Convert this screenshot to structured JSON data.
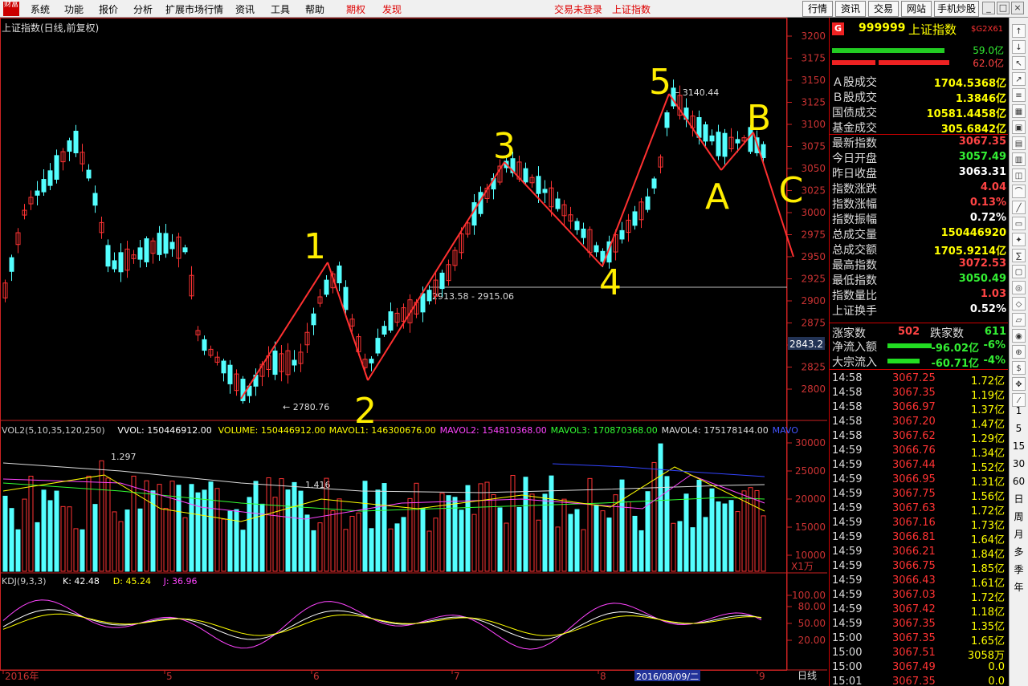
{
  "menubar": {
    "logo": "财富",
    "items": [
      {
        "label": "系统",
        "red": false
      },
      {
        "label": "功能",
        "red": false
      },
      {
        "label": "报价",
        "red": false
      },
      {
        "label": "分析",
        "red": false
      },
      {
        "label": "扩展市场行情",
        "red": false
      },
      {
        "label": "资讯",
        "red": false
      },
      {
        "label": "工具",
        "red": false
      },
      {
        "label": "帮助",
        "red": false
      },
      {
        "label": "期权",
        "red": true
      },
      {
        "label": "发现",
        "red": true
      }
    ],
    "status_login": "交易未登录",
    "status_index": "上证指数",
    "buttons": [
      "行情",
      "资讯",
      "交易",
      "网站",
      "手机炒股"
    ],
    "window_controls": [
      "_",
      "□",
      "×"
    ]
  },
  "chart": {
    "title": "上证指数(日线,前复权)",
    "y_ticks": [
      "3200",
      "3175",
      "3150",
      "3125",
      "3100",
      "3075",
      "3050",
      "3025",
      "3000",
      "2975",
      "2950",
      "2925",
      "2900",
      "2875",
      "2850",
      "2825",
      "2800"
    ],
    "crosshair_value": "2843.2",
    "annotations": {
      "high": "3140.44",
      "low": "2780.76",
      "gap": "2913.58 - 2915.06"
    },
    "wave_labels": [
      "1",
      "2",
      "3",
      "4",
      "5",
      "A",
      "B",
      "C"
    ],
    "volume": {
      "legend": [
        {
          "text": "VOL2(5,10,35,120,250)",
          "color": "#cccccc"
        },
        {
          "text": "VVOL: 150446912.00",
          "color": "#ffffff"
        },
        {
          "text": "VOLUME: 150446912.00",
          "color": "#ffff00"
        },
        {
          "text": "MAVOL1: 146300676.00",
          "color": "#ffff00"
        },
        {
          "text": "MAVOL2: 154810368.00",
          "color": "#ff44ff"
        },
        {
          "text": "MAVOL3: 170870368.00",
          "color": "#33ff33"
        },
        {
          "text": "MAVOL4: 175178144.00",
          "color": "#dddddd"
        },
        {
          "text": "MAVO",
          "color": "#4455ff"
        }
      ],
      "y_ticks": [
        "30000",
        "25000",
        "20000",
        "15000",
        "10000"
      ],
      "unit": "X1万",
      "peak_labels": [
        "1.297",
        "1.416"
      ]
    },
    "kdj": {
      "legend": [
        {
          "text": "KDJ(9,3,3)",
          "color": "#cccccc"
        },
        {
          "text": "K: 42.48",
          "color": "#ffffff"
        },
        {
          "text": "D: 45.24",
          "color": "#ffff00"
        },
        {
          "text": "J: 36.96",
          "color": "#ff44ff"
        }
      ],
      "y_ticks": [
        "100.00",
        "80.00",
        "50.00",
        "20.00"
      ]
    },
    "x_axis": [
      "2016年",
      "5",
      "6",
      "7",
      "8",
      "9"
    ],
    "x_highlight": "2016/08/09/二",
    "period": "日线"
  },
  "panel": {
    "code": "999999",
    "name": "上证指数",
    "badge": "G",
    "tag": "$G2X61",
    "bar_values": [
      "59.0亿",
      "62.0亿"
    ],
    "rows": [
      {
        "label": "Ａ股成交",
        "value": "1704.5368亿",
        "color": "#ffff00"
      },
      {
        "label": "Ｂ股成交",
        "value": "1.3846亿",
        "color": "#ffff00"
      },
      {
        "label": "国债成交",
        "value": "10581.4458亿",
        "color": "#ffff00"
      },
      {
        "label": "基金成交",
        "value": "305.6842亿",
        "color": "#ffff00"
      },
      {
        "label": "最新指数",
        "value": "3067.35",
        "color": "#ff4444"
      },
      {
        "label": "今日开盘",
        "value": "3057.49",
        "color": "#33ee33"
      },
      {
        "label": "昨日收盘",
        "value": "3063.31",
        "color": "#ffffff"
      },
      {
        "label": "指数涨跌",
        "value": "4.04",
        "color": "#ff4444"
      },
      {
        "label": "指数涨幅",
        "value": "0.13%",
        "color": "#ff4444"
      },
      {
        "label": "指数振幅",
        "value": "0.72%",
        "color": "#ffffff"
      },
      {
        "label": "总成交量",
        "value": "150446920",
        "color": "#ffff00"
      },
      {
        "label": "总成交额",
        "value": "1705.9214亿",
        "color": "#ffff00"
      },
      {
        "label": "最高指数",
        "value": "3072.53",
        "color": "#ff4444"
      },
      {
        "label": "最低指数",
        "value": "3050.49",
        "color": "#33ee33"
      },
      {
        "label": "指数量比",
        "value": "1.03",
        "color": "#ff4444"
      },
      {
        "label": "上证换手",
        "value": "0.52%",
        "color": "#ffffff"
      }
    ],
    "rise_label": "涨家数",
    "rise_value": "502",
    "fall_label": "跌家数",
    "fall_value": "611",
    "flows": [
      {
        "label": "净流入额",
        "value": "-96.02亿",
        "pct": "-6%"
      },
      {
        "label": "大宗流入",
        "value": "-60.71亿",
        "pct": "-4%"
      }
    ],
    "ticks": [
      {
        "time": "14:58",
        "price": "3067.25",
        "vol": "1.72亿"
      },
      {
        "time": "14:58",
        "price": "3067.35",
        "vol": "1.19亿"
      },
      {
        "time": "14:58",
        "price": "3066.97",
        "vol": "1.37亿"
      },
      {
        "time": "14:58",
        "price": "3067.20",
        "vol": "1.47亿"
      },
      {
        "time": "14:58",
        "price": "3067.62",
        "vol": "1.29亿"
      },
      {
        "time": "14:59",
        "price": "3066.76",
        "vol": "1.34亿"
      },
      {
        "time": "14:59",
        "price": "3067.44",
        "vol": "1.52亿"
      },
      {
        "time": "14:59",
        "price": "3066.95",
        "vol": "1.31亿"
      },
      {
        "time": "14:59",
        "price": "3067.75",
        "vol": "1.56亿"
      },
      {
        "time": "14:59",
        "price": "3067.63",
        "vol": "1.72亿"
      },
      {
        "time": "14:59",
        "price": "3067.16",
        "vol": "1.73亿"
      },
      {
        "time": "14:59",
        "price": "3066.81",
        "vol": "1.64亿"
      },
      {
        "time": "14:59",
        "price": "3066.21",
        "vol": "1.84亿"
      },
      {
        "time": "14:59",
        "price": "3066.75",
        "vol": "1.85亿"
      },
      {
        "time": "14:59",
        "price": "3066.43",
        "vol": "1.61亿"
      },
      {
        "time": "14:59",
        "price": "3067.03",
        "vol": "1.72亿"
      },
      {
        "time": "14:59",
        "price": "3067.42",
        "vol": "1.18亿"
      },
      {
        "time": "14:59",
        "price": "3067.35",
        "vol": "1.35亿"
      },
      {
        "time": "15:00",
        "price": "3067.35",
        "vol": "1.65亿"
      },
      {
        "time": "15:00",
        "price": "3067.51",
        "vol": "3058万"
      },
      {
        "time": "15:00",
        "price": "3067.49",
        "vol": "0.0"
      },
      {
        "time": "15:01",
        "price": "3067.35",
        "vol": "0.0"
      }
    ]
  },
  "toolstrip": {
    "period_labels": [
      "1",
      "5",
      "15",
      "30",
      "60",
      "日",
      "周",
      "月",
      "多",
      "季",
      "年"
    ]
  },
  "colors": {
    "up": "#ff3333",
    "down": "#54ffff",
    "axis": "#cc2222",
    "wave_arrow": "#ff3030",
    "wave_label": "#ffee00"
  }
}
